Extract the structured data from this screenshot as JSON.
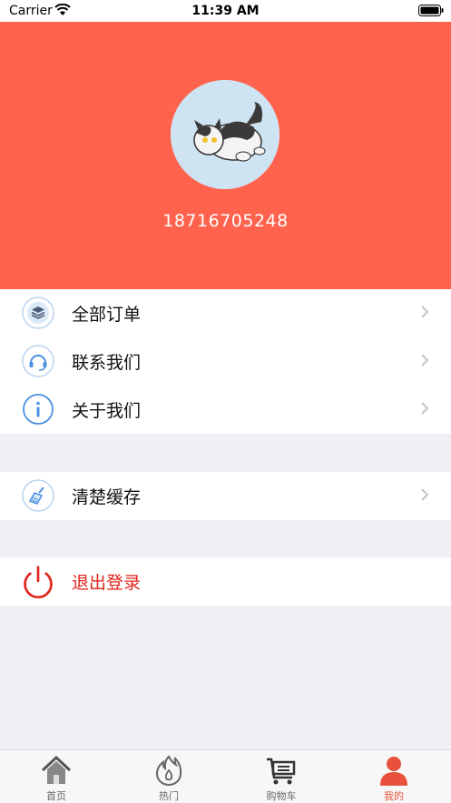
{
  "status_bar": {
    "carrier": "Carrier",
    "time": "11:39 AM"
  },
  "profile": {
    "phone": "18716705248"
  },
  "menu_group_1": [
    {
      "label": "全部订单",
      "icon": "layers-icon"
    },
    {
      "label": "联系我们",
      "icon": "headset-icon"
    },
    {
      "label": "关于我们",
      "icon": "info-icon"
    }
  ],
  "menu_group_2": [
    {
      "label": "清楚缓存",
      "icon": "broom-icon"
    }
  ],
  "logout": {
    "label": "退出登录",
    "icon": "power-icon"
  },
  "tabbar": {
    "tabs": [
      {
        "label": "首页",
        "icon": "home-icon"
      },
      {
        "label": "热门",
        "icon": "flame-icon"
      },
      {
        "label": "购物车",
        "icon": "cart-icon"
      },
      {
        "label": "我的",
        "icon": "person-icon"
      }
    ],
    "active_index": 3
  },
  "colors": {
    "header": "#ff634d",
    "logout": "#e0231b",
    "icon_blue": "#4a90e2",
    "tab_active": "#e8523d"
  }
}
